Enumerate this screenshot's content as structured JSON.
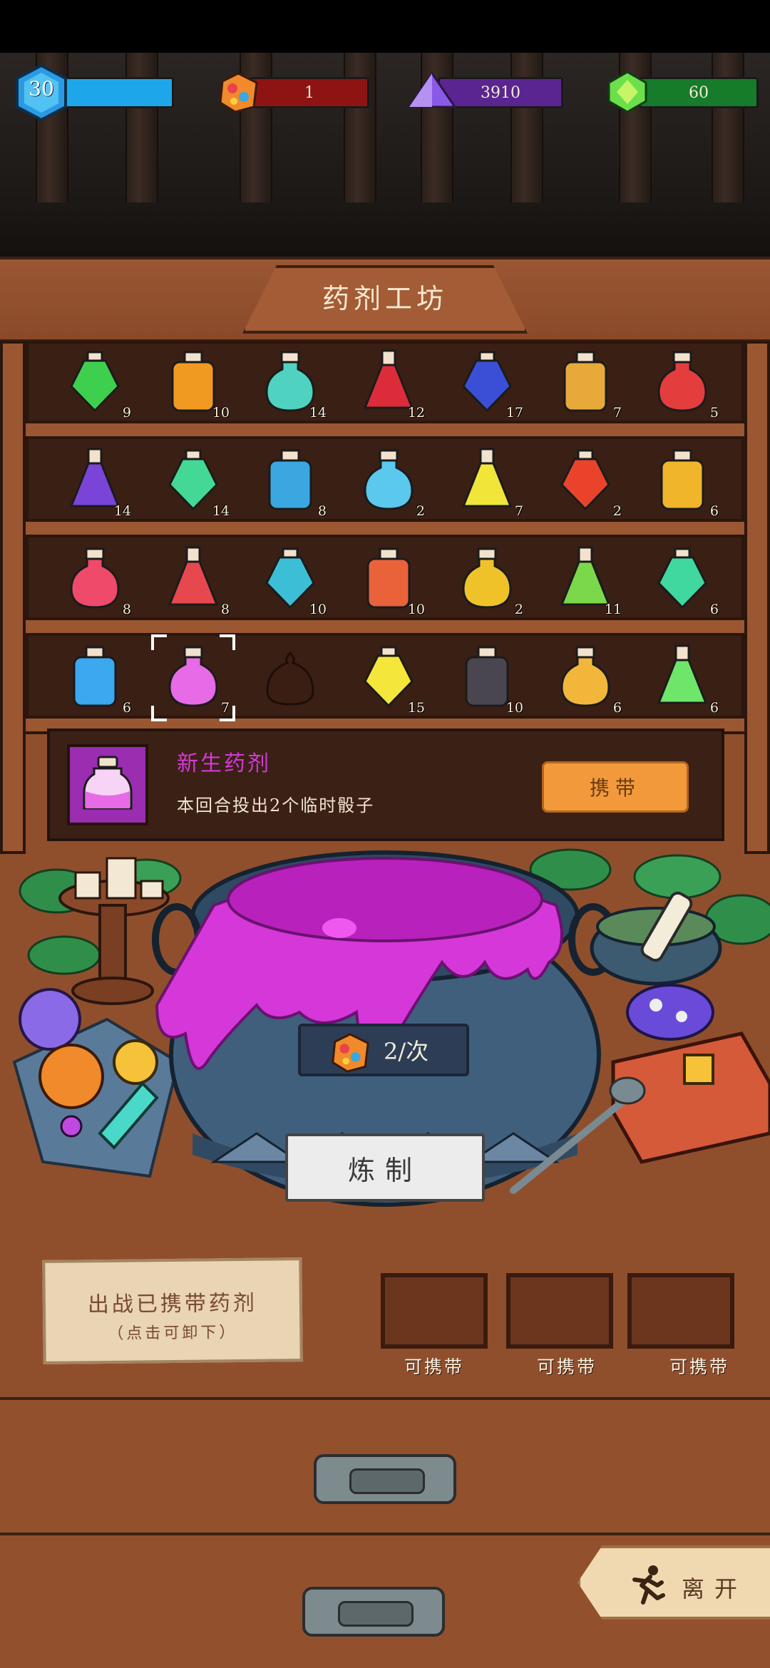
{
  "resources": {
    "level": {
      "value": "30",
      "icon": "blue-hexagon-badge-icon",
      "color": "#1da7ea"
    },
    "dice": {
      "value": "1",
      "icon": "orange-dice-icon",
      "color": "#8e1414"
    },
    "crystal": {
      "value": "3910",
      "icon": "purple-crystal-icon",
      "color": "#5a2590"
    },
    "gem": {
      "value": "60",
      "icon": "green-gem-icon",
      "color": "#167b2a"
    }
  },
  "title": "药剂工坊",
  "shelf": {
    "rows": [
      [
        {
          "count": "9",
          "color": "#3fcf4e",
          "icon": "green-potion-icon"
        },
        {
          "count": "10",
          "color": "#f19a22",
          "icon": "orange-potion-icon"
        },
        {
          "count": "14",
          "color": "#4fd3c0",
          "icon": "rainbow-potion-icon"
        },
        {
          "count": "12",
          "color": "#dc2c3a",
          "icon": "red-potion-icon"
        },
        {
          "count": "17",
          "color": "#3b4fd6",
          "icon": "blue-potion-icon"
        },
        {
          "count": "7",
          "color": "#e7a93a",
          "icon": "amber-potion-icon"
        },
        {
          "count": "5",
          "color": "#e43d3d",
          "icon": "red-jar-potion-icon"
        }
      ],
      [
        {
          "count": "14",
          "color": "#7a44d8",
          "icon": "purple-potion-icon"
        },
        {
          "count": "14",
          "color": "#44d896",
          "icon": "mint-potion-icon"
        },
        {
          "count": "8",
          "color": "#3aa7e0",
          "icon": "blue-flask-potion-icon"
        },
        {
          "count": "2",
          "color": "#5bc8ee",
          "icon": "cyan-potion-icon"
        },
        {
          "count": "7",
          "color": "#f1e53a",
          "icon": "yellow-potion-icon"
        },
        {
          "count": "2",
          "color": "#e9442b",
          "icon": "fire-potion-icon"
        },
        {
          "count": "6",
          "color": "#f0b52a",
          "icon": "gold-red-potion-icon"
        }
      ],
      [
        {
          "count": "8",
          "color": "#ef4a6a",
          "icon": "pink-potion-icon"
        },
        {
          "count": "8",
          "color": "#e7484e",
          "icon": "rose-potion-icon"
        },
        {
          "count": "10",
          "color": "#3cbfd6",
          "icon": "teal-potion-icon"
        },
        {
          "count": "10",
          "color": "#e9623a",
          "icon": "coral-potion-icon"
        },
        {
          "count": "2",
          "color": "#f0c22a",
          "icon": "heart-potion-icon"
        },
        {
          "count": "11",
          "color": "#7bd84a",
          "icon": "gradient-potion-icon"
        },
        {
          "count": "6",
          "color": "#41d8a0",
          "icon": "sprout-potion-icon"
        }
      ],
      [
        {
          "count": "6",
          "color": "#3ba8ef",
          "icon": "blue-gold-potion-icon"
        },
        {
          "count": "7",
          "color": "#e76ae6",
          "icon": "newborn-potion-icon",
          "selected": true
        },
        {
          "count": "",
          "color": "#3a1e14",
          "icon": "locked-pouch-icon",
          "locked": true
        },
        {
          "count": "15",
          "color": "#f4e63a",
          "icon": "yellow-jar-potion-icon"
        },
        {
          "count": "10",
          "color": "#4a4650",
          "icon": "dark-bow-potion-icon"
        },
        {
          "count": "6",
          "color": "#f2b63a",
          "icon": "orange-jar-potion-icon"
        },
        {
          "count": "6",
          "color": "#6de66a",
          "icon": "lime-potion-icon"
        }
      ]
    ]
  },
  "detail": {
    "name": "新生药剂",
    "description": "本回合投出2个临时骰子",
    "carry_label": "携带",
    "thumb_color": "#e76ae6"
  },
  "cauldron": {
    "uses": "2/次",
    "brew_label": "炼制",
    "slime_color": "#d637d8"
  },
  "carried": {
    "title": "出战已携带药剂",
    "subtitle": "（点击可卸下）",
    "slots": [
      {
        "label": "可携带"
      },
      {
        "label": "可携带"
      },
      {
        "label": "可携带"
      }
    ]
  },
  "leave": {
    "label": "离开",
    "icon": "running-man-icon"
  }
}
